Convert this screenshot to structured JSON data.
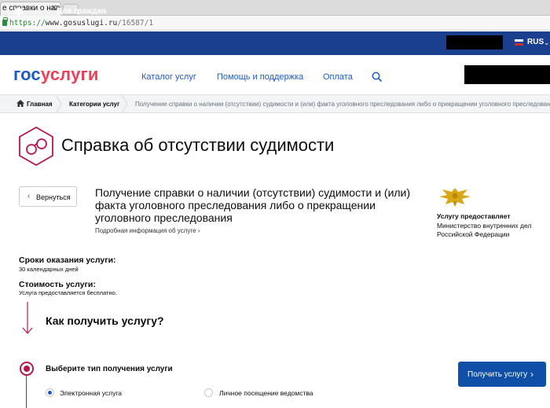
{
  "browser": {
    "tab_title": "е справки о наличи",
    "tab_close": "✕",
    "url_scheme": "https://",
    "url_host": "www.gosuslugi.ru",
    "url_path": "/16587/1"
  },
  "topbar": {
    "emblem_caret": "⌄",
    "for_citizens": "Для граждан",
    "for_citizens_caret": "⌄",
    "lang": "RUS",
    "lang_caret": "⌄",
    "flag_colors": [
      "#ffffff",
      "#1c3fa8",
      "#d52b1e"
    ]
  },
  "header": {
    "logo_part1": "гос",
    "logo_part2": "услуги",
    "nav": [
      "Каталог услуг",
      "Помощь и поддержка",
      "Оплата"
    ],
    "search_icon": "search-icon"
  },
  "breadcrumb": {
    "home": "Главная",
    "categories": "Категории услуг",
    "current": "Получение справки о наличии (отсутствии) судимости и (или) факта уголовного преследования либо о прекращении уголовного преследования"
  },
  "page": {
    "title": "Справка об отсутствии судимости",
    "back": "Вернуться",
    "back_chevron": "‹",
    "service_title": "Получение справки о наличии (отсутствии) судимости и (или) факта уголовного преследования либо о прекращении уголовного преследования",
    "more_info": "Подробная информация об услуге",
    "more_chevron": "›",
    "provider_head": "Услугу предоставляет",
    "provider_name": "Министерство внутренних дел Российской Федерации",
    "term_head": "Сроки оказания услуги:",
    "term_value": "30 календарных дней",
    "cost_head": "Стоимость услуги:",
    "cost_value": "Услуга предоставляется бесплатно.",
    "how_head": "Как получить услугу?",
    "step_head": "Выберите тип получения услуги",
    "option_electronic": "Электронная услуга",
    "option_visit": "Личное посещение ведомства",
    "get_button": "Получить услугу",
    "get_chevron": "›"
  },
  "colors": {
    "brand_blue": "#1e5bc4",
    "brand_red": "#ee3f58",
    "accent_crimson": "#b3184a",
    "topbar": "#1b3f8f",
    "button": "#0f4fa8"
  }
}
